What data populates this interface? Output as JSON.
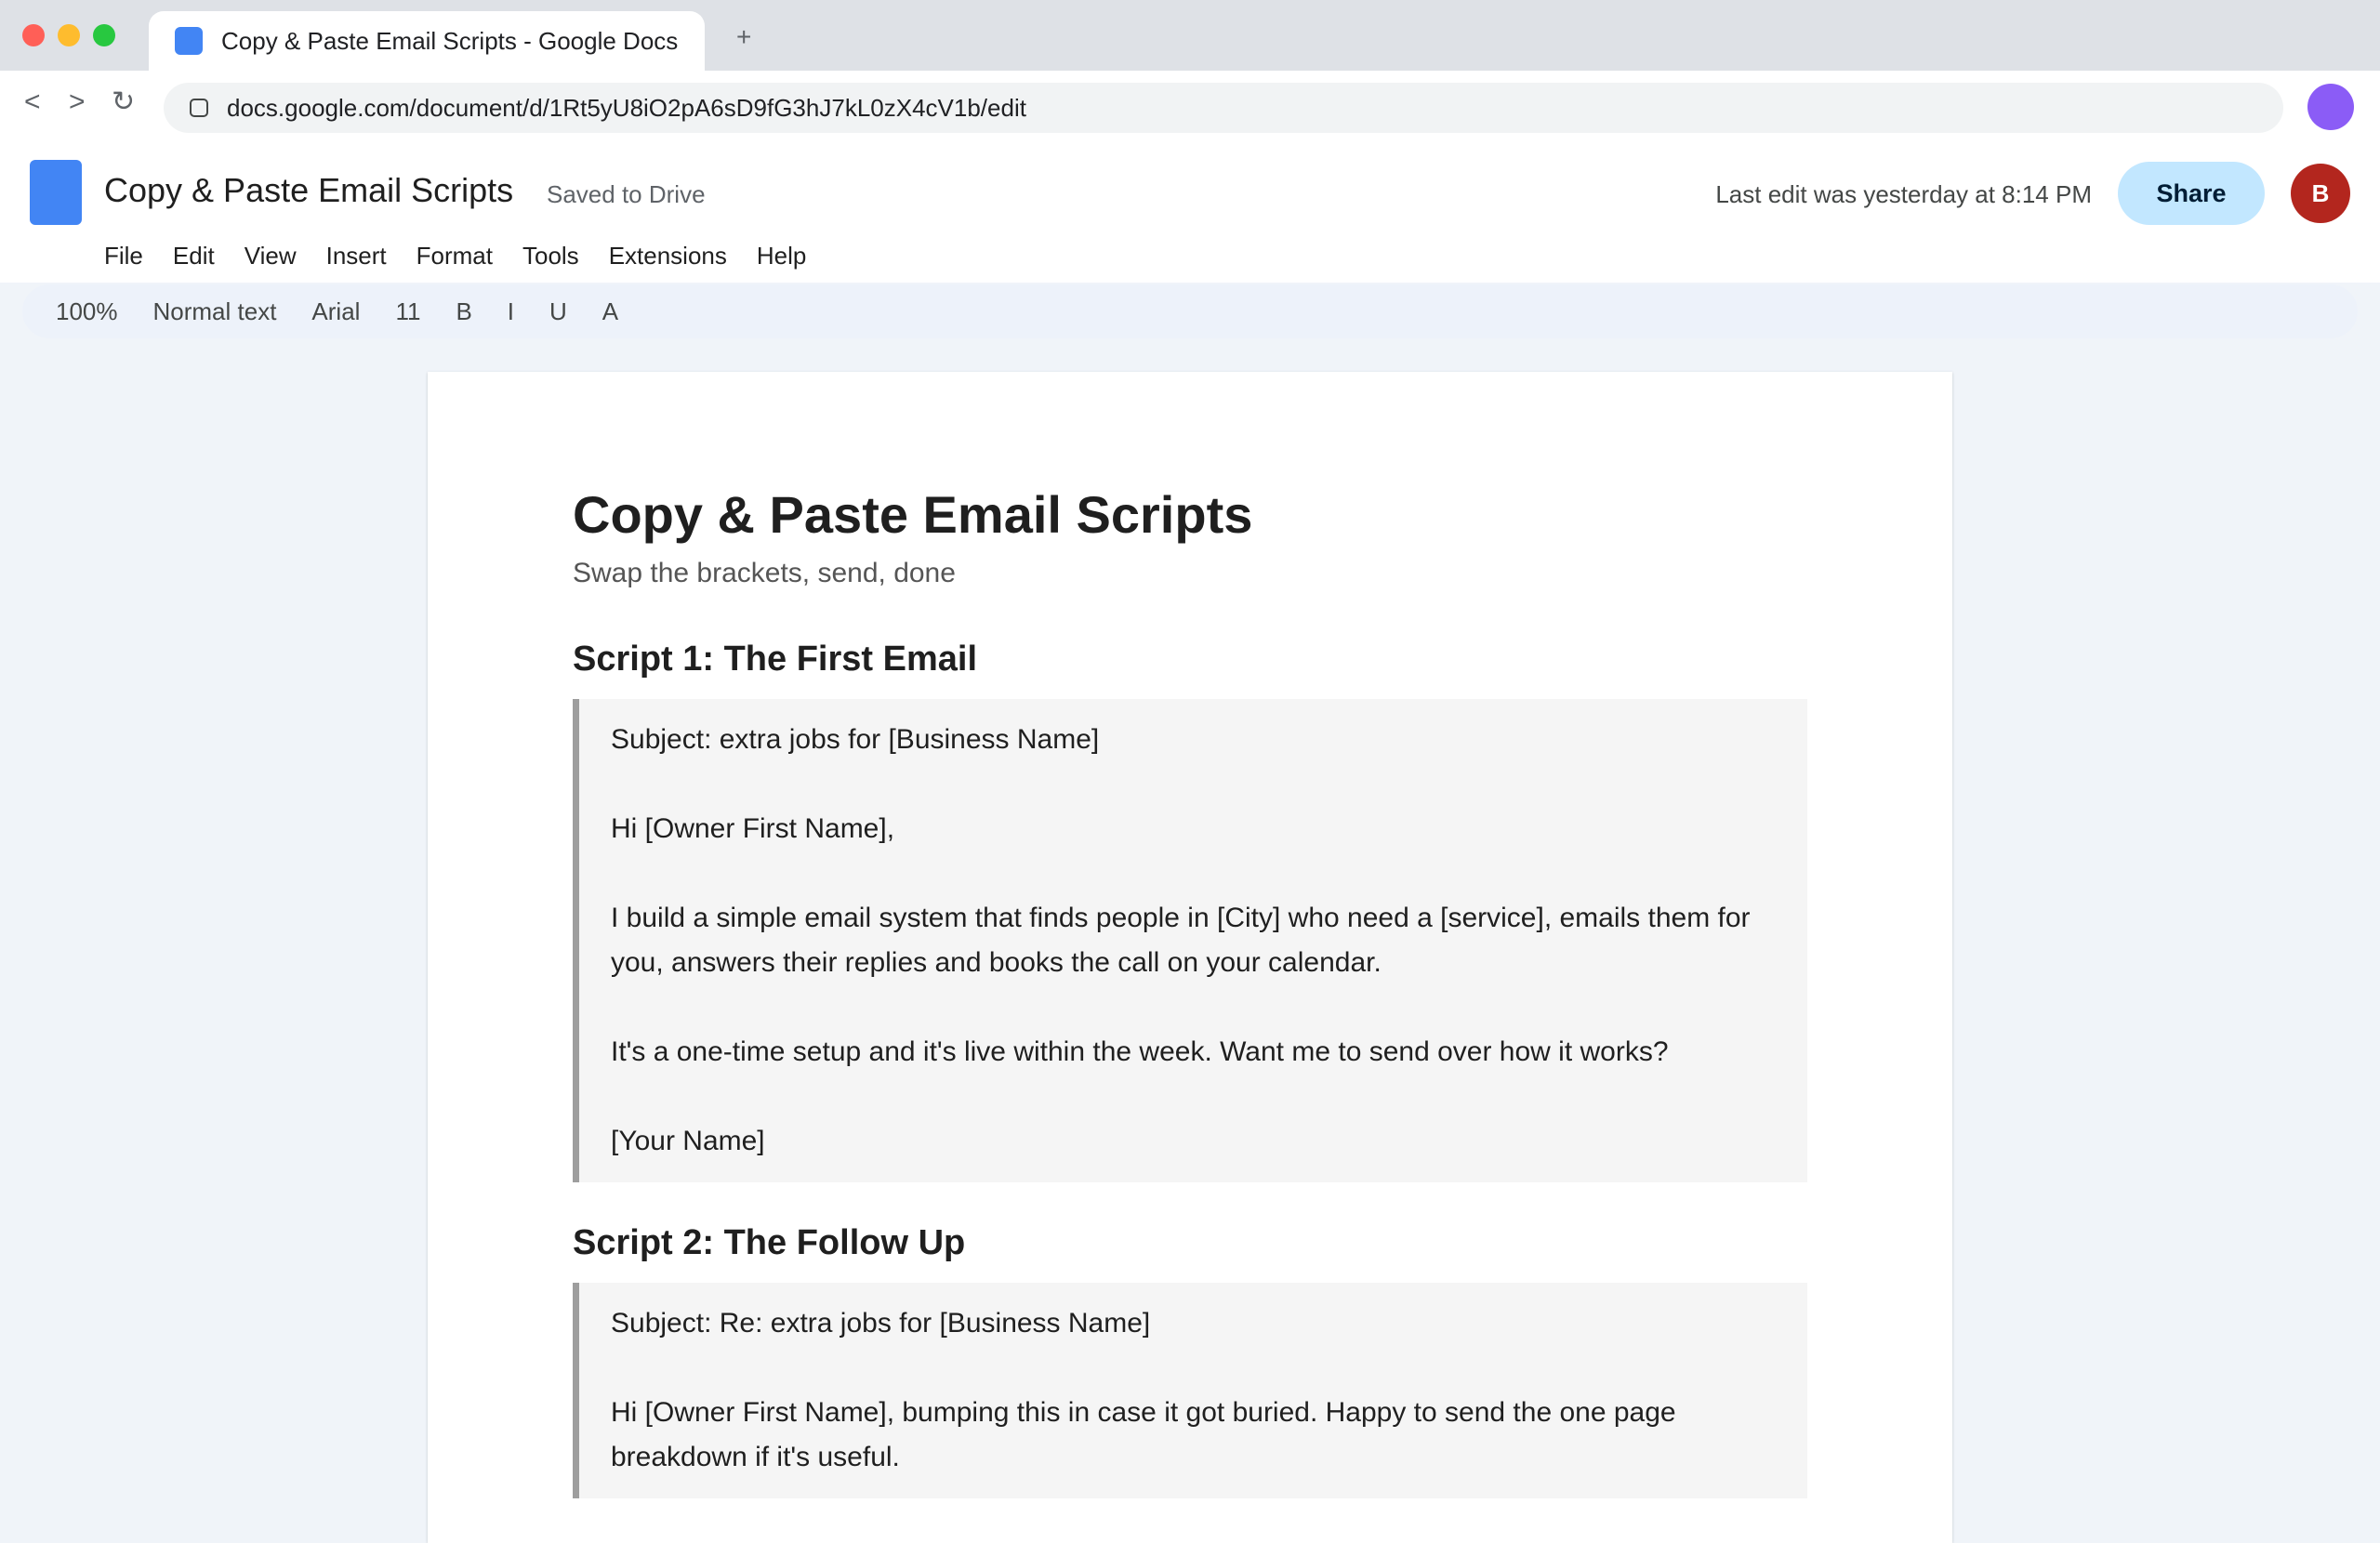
{
  "browser": {
    "tab_title": "Copy & Paste Email Scripts - Google Docs",
    "new_tab_symbol": "+",
    "nav": {
      "back": "<",
      "forward": ">",
      "reload": "↻"
    },
    "url": "docs.google.com/document/d/1Rt5yU8iO2pA6sD9fG3hJ7kL0zX4cV1b/edit"
  },
  "docs": {
    "title": "Copy & Paste Email Scripts",
    "saved_status": "Saved to Drive",
    "last_edit": "Last edit was yesterday at 8:14 PM",
    "share_label": "Share",
    "avatar_initial": "B",
    "menu": [
      "File",
      "Edit",
      "View",
      "Insert",
      "Format",
      "Tools",
      "Extensions",
      "Help"
    ],
    "toolbar": {
      "zoom": "100%",
      "style": "Normal text",
      "font": "Arial",
      "size": "11",
      "bold": "B",
      "italic": "I",
      "underline": "U",
      "text_color": "A"
    }
  },
  "document": {
    "heading": "Copy & Paste Email Scripts",
    "subtitle": "Swap the brackets, send, done",
    "scripts": [
      {
        "heading": "Script 1: The First Email",
        "subject": "Subject: extra jobs for [Business Name]",
        "greeting": "Hi [Owner First Name],",
        "body1": "I build a simple email system that finds people in [City] who need a [service], emails them for you, answers their replies and books the call on your calendar.",
        "body2": "It's a one-time setup and it's live within the week. Want me to send over how it works?",
        "signoff": "[Your Name]"
      },
      {
        "heading": "Script 2: The Follow Up",
        "subject": "Subject: Re: extra jobs for [Business Name]",
        "body1": "Hi [Owner First Name], bumping this in case it got buried. Happy to send the one page breakdown if it's useful."
      }
    ]
  },
  "colors": {
    "docs_blue": "#4285f4",
    "share_bg": "#c2e7ff",
    "avatar_bg": "#b3261e",
    "profile": "#8b5cf6",
    "toolbar_bg": "#edf2fa"
  }
}
